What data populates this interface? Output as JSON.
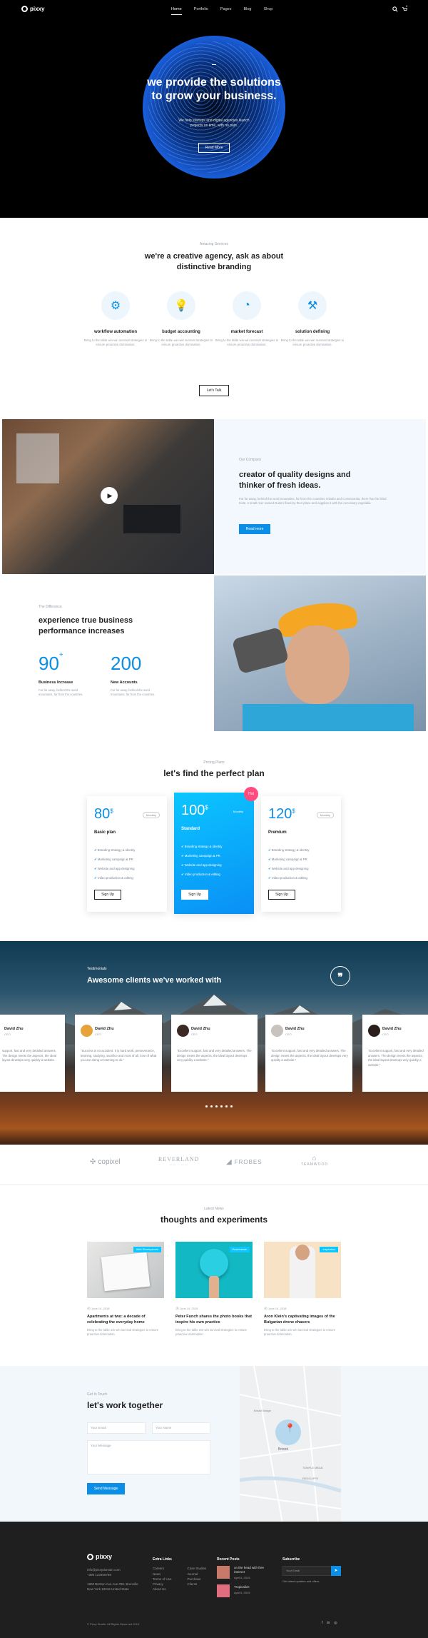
{
  "brand": {
    "name": "pixxy"
  },
  "nav": {
    "items": [
      "Home",
      "Portfolio",
      "Pages",
      "Blog",
      "Shop"
    ],
    "cart_count": "0"
  },
  "hero": {
    "title_1": "we provide the solutions",
    "title_2": "to grow your business.",
    "subtitle_1": "We help startups and digital agencies launch",
    "subtitle_2": "projects on time, with no pain.",
    "button": "Read More"
  },
  "services": {
    "kicker": "Amazing Services",
    "title_1": "we're a creative agency, ask as about",
    "title_2": "distinctive branding",
    "items": [
      {
        "icon": "gear-icon",
        "title": "workflow automation",
        "desc": "Bring to the table win-win survival strategies to ensure proactive domination."
      },
      {
        "icon": "lightbulb-icon",
        "title": "budget accounting",
        "desc": "Bring to the table win-win survival strategies to ensure proactive domination."
      },
      {
        "icon": "gauge-icon",
        "title": "market forecast",
        "desc": "Bring to the table win-win survival strategies to ensure proactive domination."
      },
      {
        "icon": "hammer-icon",
        "title": "solution defining",
        "desc": "Bring to the table win-win survival strategies to ensure proactive domination."
      }
    ],
    "button": "Let's Talk"
  },
  "company": {
    "kicker": "Our Company",
    "title_1": "creator of quality designs and",
    "title_2": "thinker of fresh ideas.",
    "desc": "Far far away, behind the word mountains, far from the countries Vokalia and Consonantia, there live the blind texts. A small river named Duden flows by their place and supplies it with the necessary regelialia.",
    "button": "Read more"
  },
  "difference": {
    "kicker": "The Difference",
    "title_1": "experience true business",
    "title_2": "performance increases",
    "stats": [
      {
        "value": "90",
        "suffix": "+",
        "label": "Business Increase",
        "desc": "Far far away, behind the word mountains, far from the countries."
      },
      {
        "value": "200",
        "suffix": "",
        "label": "New Accounts",
        "desc": "Far far away, behind the word mountains, far from the countries."
      }
    ]
  },
  "pricing": {
    "kicker": "Pricing Plans",
    "title": "let's find the perfect plan",
    "plans": [
      {
        "price": "80",
        "currency": "$",
        "period": "Monthly",
        "name": "Basic plan",
        "features": [
          "Branding strategy & identity",
          "Marketing campaign & PR",
          "Website and app designing",
          "Video production & editing"
        ],
        "button": "Sign Up"
      },
      {
        "price": "100",
        "currency": "$",
        "period": "Monthly",
        "name": "Standard",
        "badge": "Hot",
        "features": [
          "Branding strategy & identity",
          "Marketing campaign & PR",
          "Website and app designing",
          "Video production & editing"
        ],
        "button": "Sign Up"
      },
      {
        "price": "120",
        "currency": "$",
        "period": "Monthly",
        "name": "Premium",
        "features": [
          "Branding strategy & identity",
          "Marketing campaign & PR",
          "Website and app designing",
          "Video production & editing"
        ],
        "button": "Sign Up"
      }
    ]
  },
  "testimonials": {
    "kicker": "Testimonials",
    "title": "Awesome clients we've worked with",
    "items": [
      {
        "name": "David Zhu",
        "role": "CEO",
        "text": "support, fast and very detailed answers. The design meets the aspects, the ideal layout develops very quickly a website."
      },
      {
        "name": "David Zhu",
        "role": "CEO",
        "text": "\"Success is no accident. It is hard work, perseverance, learning, studying, sacrifice and most of all, love of what you are doing or learning to do.\""
      },
      {
        "name": "David Zhu",
        "role": "CEO",
        "text": "\"Excellent support, fast and very detailed answers. The design meets the aspects, the ideal layout develops very quickly a website.\""
      },
      {
        "name": "David Zhu",
        "role": "CEO",
        "text": "\"Excellent support, fast and very detailed answers. The design meets the aspects, the ideal layout develops very quickly a website.\""
      },
      {
        "name": "David Zhu",
        "role": "CEO",
        "text": "\"Excellent support, fast and very detailed answers. The design meets the aspects, the ideal layout develops very quickly a website.\""
      }
    ],
    "dots": 6
  },
  "brands": [
    {
      "name": "copixel"
    },
    {
      "name": "REVERLAND",
      "sub": "—— · ——"
    },
    {
      "name": "FROBES"
    },
    {
      "name": "TEAMWOOD"
    }
  ],
  "news": {
    "kicker": "Latest News",
    "title": "thoughts and experiments",
    "items": [
      {
        "tag": "Web Development",
        "date": "June 14, 2018",
        "title": "Apartments at two: a decade of celebrating the everyday home",
        "desc": "Bring to the table win-win survival strategies to ensure proactive domination."
      },
      {
        "tag": "Ecommerce",
        "date": "June 14, 2018",
        "title": "Peter Funch shares the photo books that inspire his own practice",
        "desc": "Bring to the table win-win survival strategies to ensure proactive domination."
      },
      {
        "tag": "Inspiration",
        "date": "June 14, 2018",
        "title": "Aron Klein's captivating images of the Bulgarian drone chasers",
        "desc": "Bring to the table win-win survival strategies to ensure proactive domination."
      }
    ]
  },
  "contact": {
    "kicker": "Get In Touch",
    "title": "let's work together",
    "email_placeholder": "Your Email",
    "name_placeholder": "Your Name",
    "message_placeholder": "Your Message",
    "button": "Send Message",
    "map_labels": [
      "TEMPLE MEAD",
      "REDCLIFFE",
      "Bristol",
      "Bristol Bridge"
    ]
  },
  "footer": {
    "contact_lines": [
      "info@pixxydomain.com",
      "+386 123456789",
      "1900 Bretton Ave Ave #88, Brenville",
      "New York 10016 United State"
    ],
    "extra_title": "Extra Links",
    "extra_col1": [
      "Careers",
      "News",
      "Terms of Use",
      "Privacy",
      "About Us"
    ],
    "extra_col2": [
      "Case Studies",
      "Journal",
      "Purchase",
      "Clients"
    ],
    "recent_title": "Recent Posts",
    "recent": [
      {
        "title": "on the head with free internet",
        "date": "April 6, 2019"
      },
      {
        "title": "Tropicalize",
        "date": "April 6, 2019"
      }
    ],
    "subscribe_title": "Subscribe",
    "subscribe_placeholder": "Your Email",
    "subscribe_note": "Get latest updates and offers.",
    "copyright": "© Pixxy Studio. All Rights Reserved 2019",
    "social": [
      "facebook-icon",
      "linkedin-icon",
      "dribbble-icon"
    ]
  },
  "colors": {
    "accent": "#0b8fe6",
    "dark": "#1f1f1f",
    "light_bg": "#f2f7fc",
    "hot": "#ff4b7d"
  }
}
